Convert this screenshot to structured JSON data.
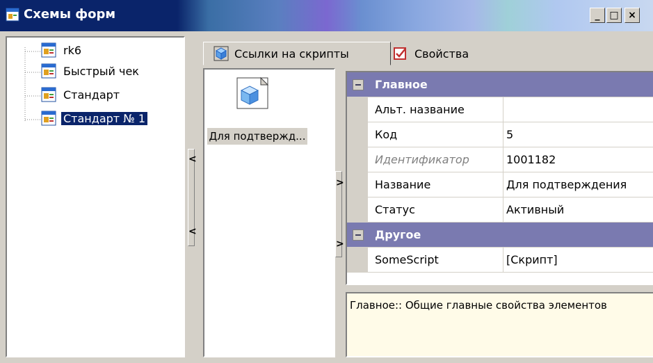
{
  "window": {
    "title": "Схемы форм",
    "minimize_glyph": "_",
    "maximize_glyph": "□",
    "close_glyph": "×"
  },
  "tree": {
    "items": [
      {
        "label": "rk6",
        "selected": false
      },
      {
        "label": "Быстрый чек",
        "selected": false
      },
      {
        "label": "Стандарт",
        "selected": false
      },
      {
        "label": "Стандарт № 1",
        "selected": true
      }
    ]
  },
  "splitters": {
    "left_arrow": "<",
    "right_arrow": ">"
  },
  "tabs": [
    {
      "label": "Ссылки на скрипты",
      "active": true
    },
    {
      "label": "Свойства",
      "active": false
    }
  ],
  "scripts_list": {
    "items": [
      {
        "label": "Для подтвержд..."
      }
    ]
  },
  "property_grid": {
    "categories": [
      {
        "label": "Главное",
        "rows": [
          {
            "name": "Альт. название",
            "value": "",
            "disabled": false
          },
          {
            "name": "Код",
            "value": "5",
            "disabled": false
          },
          {
            "name": "Идентификатор",
            "value": "1001182",
            "disabled": true
          },
          {
            "name": "Название",
            "value": "Для подтверждения",
            "disabled": false
          },
          {
            "name": "Статус",
            "value": "Активный",
            "disabled": false
          }
        ]
      },
      {
        "label": "Другое",
        "rows": [
          {
            "name": "SomeScript",
            "value": "[Скрипт]",
            "disabled": false
          }
        ]
      }
    ],
    "description": "Главное:: Общие главные свойства элементов"
  },
  "colors": {
    "title_bar": "#0a246a",
    "selection": "#0a246a",
    "category_header": "#7a7ab0",
    "description_bg": "#fffbe8"
  }
}
